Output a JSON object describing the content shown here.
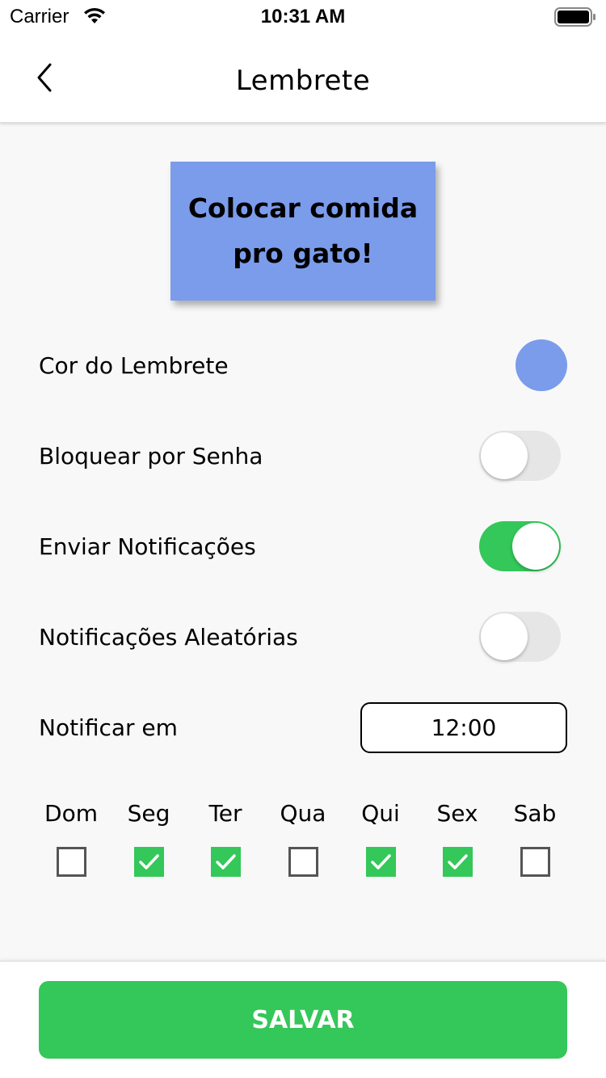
{
  "status_bar": {
    "carrier": "Carrier",
    "time": "10:31 AM",
    "icons": [
      "wifi-icon",
      "battery-icon"
    ]
  },
  "nav": {
    "title": "Lembrete",
    "back_icon": "chevron-left-icon"
  },
  "note": {
    "text": "Colocar comida pro gato!",
    "color": "#7b9ceb"
  },
  "settings": {
    "color_label": "Cor do Lembrete",
    "color_value": "#7b9ceb",
    "password_label": "Bloquear por Senha",
    "password_on": false,
    "notifications_label": "Enviar Notificações",
    "notifications_on": true,
    "random_label": "Notificações Aleatórias",
    "random_on": false,
    "notify_at_label": "Notificar em",
    "notify_at_value": "12:00"
  },
  "days": [
    {
      "label": "Dom",
      "checked": false
    },
    {
      "label": "Seg",
      "checked": true
    },
    {
      "label": "Ter",
      "checked": true
    },
    {
      "label": "Qua",
      "checked": false
    },
    {
      "label": "Qui",
      "checked": true
    },
    {
      "label": "Sex",
      "checked": true
    },
    {
      "label": "Sab",
      "checked": false
    }
  ],
  "footer": {
    "save_label": "SALVAR"
  },
  "colors": {
    "accent_green": "#34c759",
    "toggle_off": "#e6e6e6"
  }
}
